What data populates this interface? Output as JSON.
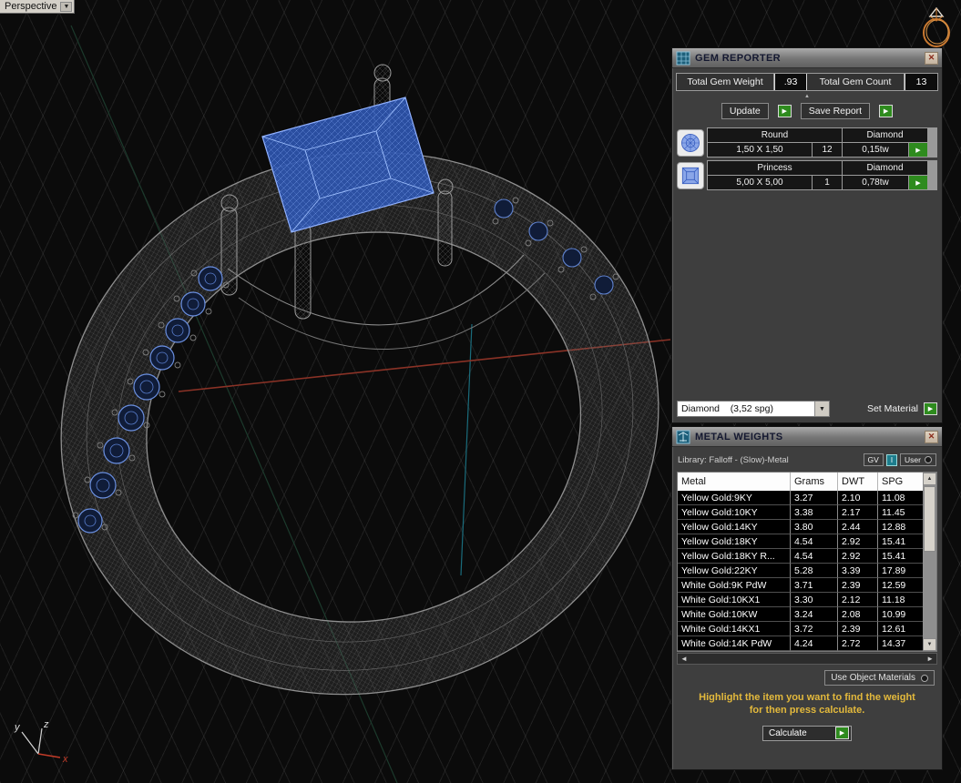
{
  "icons": {
    "close": "✕",
    "dropdown": "▼",
    "play": "▶",
    "collapse": "▲",
    "scroll_up": "▲",
    "scroll_down": "▼",
    "scroll_left": "◄",
    "scroll_right": "►"
  },
  "viewport": {
    "label": "Perspective",
    "axis_x": "x",
    "axis_y": "y",
    "axis_z": "z"
  },
  "gem_reporter": {
    "title": "GEM REPORTER",
    "total_gem_weight_label": "Total Gem Weight",
    "total_gem_weight_value": ".93",
    "total_gem_count_label": "Total Gem Count",
    "total_gem_count_value": "13",
    "update_label": "Update",
    "save_report_label": "Save Report",
    "gems": [
      {
        "shape": "Round",
        "size": "1,50 X 1,50",
        "material": "Diamond",
        "count": "12",
        "weight": "0,15tw"
      },
      {
        "shape": "Princess",
        "size": "5,00 X 5,00",
        "material": "Diamond",
        "count": "1",
        "weight": "0,78tw"
      }
    ],
    "material_dropdown_value": "Diamond    (3,52 spg)",
    "set_material_label": "Set Material"
  },
  "metal_weights": {
    "title": "METAL WEIGHTS",
    "library_label": "Library: Falloff - (Slow)-Metal",
    "gv_label": "GV",
    "gv_indicator": "I",
    "user_label": "User",
    "columns": [
      "Metal",
      "Grams",
      "DWT",
      "SPG"
    ],
    "rows": [
      [
        "Yellow Gold:9KY",
        "3.27",
        "2.10",
        "11.08"
      ],
      [
        "Yellow Gold:10KY",
        "3.38",
        "2.17",
        "11.45"
      ],
      [
        "Yellow Gold:14KY",
        "3.80",
        "2.44",
        "12.88"
      ],
      [
        "Yellow Gold:18KY",
        "4.54",
        "2.92",
        "15.41"
      ],
      [
        "Yellow Gold:18KY R...",
        "4.54",
        "2.92",
        "15.41"
      ],
      [
        "Yellow Gold:22KY",
        "5.28",
        "3.39",
        "17.89"
      ],
      [
        "White Gold:9K PdW",
        "3.71",
        "2.39",
        "12.59"
      ],
      [
        "White Gold:10KX1",
        "3.30",
        "2.12",
        "11.18"
      ],
      [
        "White Gold:10KW",
        "3.24",
        "2.08",
        "10.99"
      ],
      [
        "White Gold:14KX1",
        "3.72",
        "2.39",
        "12.61"
      ],
      [
        "White Gold:14K PdW",
        "4.24",
        "2.72",
        "14.37"
      ]
    ],
    "use_object_materials_label": "Use Object Materials",
    "instruction_line1": "Highlight the item you want to find the weight",
    "instruction_line2": "for then press calculate.",
    "calculate_label": "Calculate"
  },
  "colors": {
    "accent_green": "#2e8b1e",
    "gem_blue": "#4a6fd4",
    "highlight_yellow": "#e3b93c"
  }
}
